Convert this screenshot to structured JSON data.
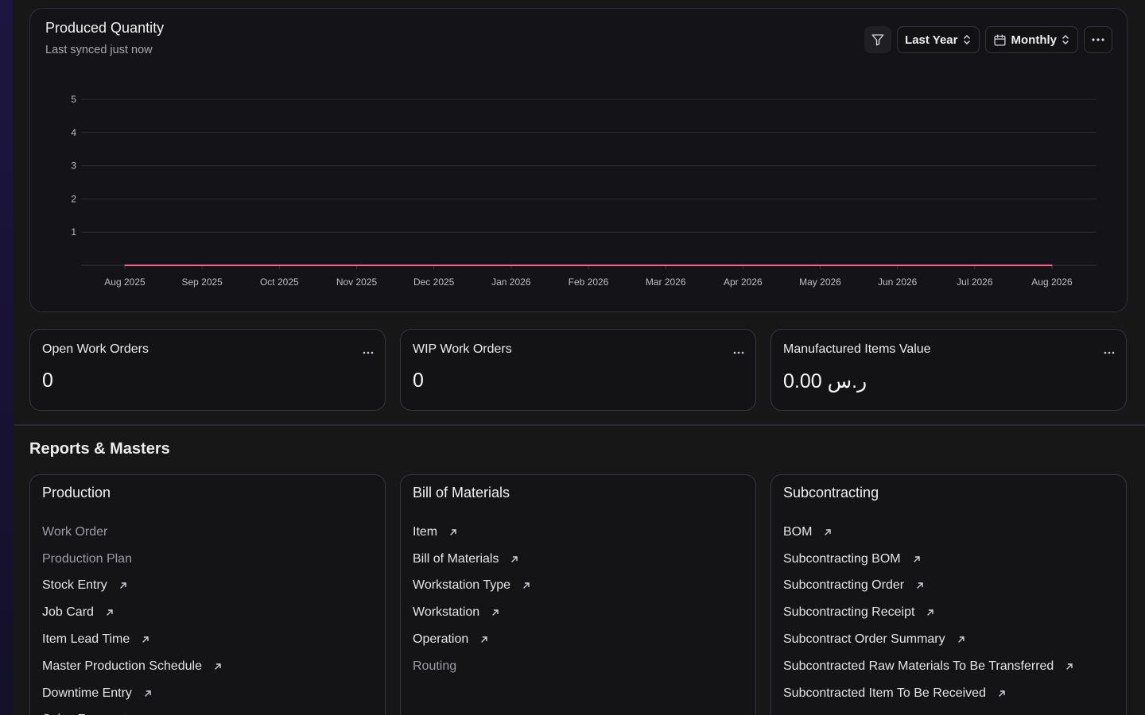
{
  "chart_card": {
    "title": "Produced Quantity",
    "subtitle": "Last synced just now",
    "range_select": "Last Year",
    "interval_select": "Monthly"
  },
  "chart_data": {
    "type": "line",
    "title": "Produced Quantity",
    "x": [
      "Aug 2025",
      "Sep 2025",
      "Oct 2025",
      "Nov 2025",
      "Dec 2025",
      "Jan 2026",
      "Feb 2026",
      "Mar 2026",
      "Apr 2026",
      "May 2026",
      "Jun 2026",
      "Jul 2026",
      "Aug 2026"
    ],
    "y_ticks": [
      "1",
      "2",
      "3",
      "4",
      "5"
    ],
    "ylim": [
      0,
      5
    ],
    "grid": true,
    "series": [
      {
        "color": "#f06a8a",
        "values": [
          0,
          0,
          0,
          0,
          0,
          0,
          0,
          0,
          0,
          0,
          0,
          0,
          0
        ]
      }
    ]
  },
  "kpis": [
    {
      "title": "Open Work Orders",
      "value": "0"
    },
    {
      "title": "WIP Work Orders",
      "value": "0"
    },
    {
      "title": "Manufactured Items Value",
      "value": "0.00 ر.س"
    }
  ],
  "section_title": "Reports & Masters",
  "report_cards": [
    {
      "title": "Production",
      "items": [
        {
          "label": "Work Order",
          "link": false
        },
        {
          "label": "Production Plan",
          "link": false
        },
        {
          "label": "Stock Entry",
          "link": true
        },
        {
          "label": "Job Card",
          "link": true
        },
        {
          "label": "Item Lead Time",
          "link": true
        },
        {
          "label": "Master Production Schedule",
          "link": true
        },
        {
          "label": "Downtime Entry",
          "link": true
        },
        {
          "label": "Sales Forecast",
          "link": true
        }
      ]
    },
    {
      "title": "Bill of Materials",
      "items": [
        {
          "label": "Item",
          "link": true
        },
        {
          "label": "Bill of Materials",
          "link": true
        },
        {
          "label": "Workstation Type",
          "link": true
        },
        {
          "label": "Workstation",
          "link": true
        },
        {
          "label": "Operation",
          "link": true
        },
        {
          "label": "Routing",
          "link": false
        }
      ]
    },
    {
      "title": "Subcontracting",
      "items": [
        {
          "label": "BOM",
          "link": true
        },
        {
          "label": "Subcontracting BOM",
          "link": true
        },
        {
          "label": "Subcontracting Order",
          "link": true
        },
        {
          "label": "Subcontracting Receipt",
          "link": true
        },
        {
          "label": "Subcontract Order Summary",
          "link": true
        },
        {
          "label": "Subcontracted Raw Materials To Be Transferred",
          "link": true
        },
        {
          "label": "Subcontracted Item To Be Received",
          "link": true
        }
      ]
    }
  ]
}
